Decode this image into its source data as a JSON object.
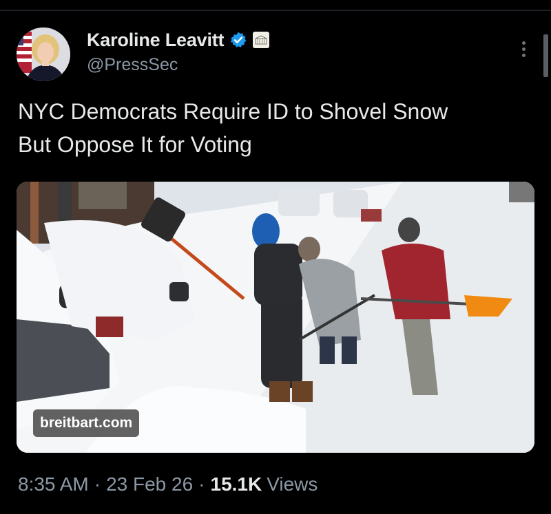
{
  "author": {
    "display_name": "Karoline Leavitt",
    "handle": "@PressSec",
    "verified_icon": "verified-badge-icon",
    "org_badge_icon": "white-house-badge-icon"
  },
  "tweet": {
    "lines": [
      "NYC Democrats Require ID to Shovel Snow",
      "But Oppose It for Voting"
    ]
  },
  "media": {
    "source_label": "breitbart.com"
  },
  "meta": {
    "time": "8:35 AM",
    "date": "23 Feb 26",
    "separator": "·",
    "views_count": "15.1K",
    "views_label": "Views"
  },
  "colors": {
    "background": "#000000",
    "primary_text": "#e7e9ea",
    "secondary_text": "#8b98a5",
    "verified_blue": "#1d9bf0"
  }
}
